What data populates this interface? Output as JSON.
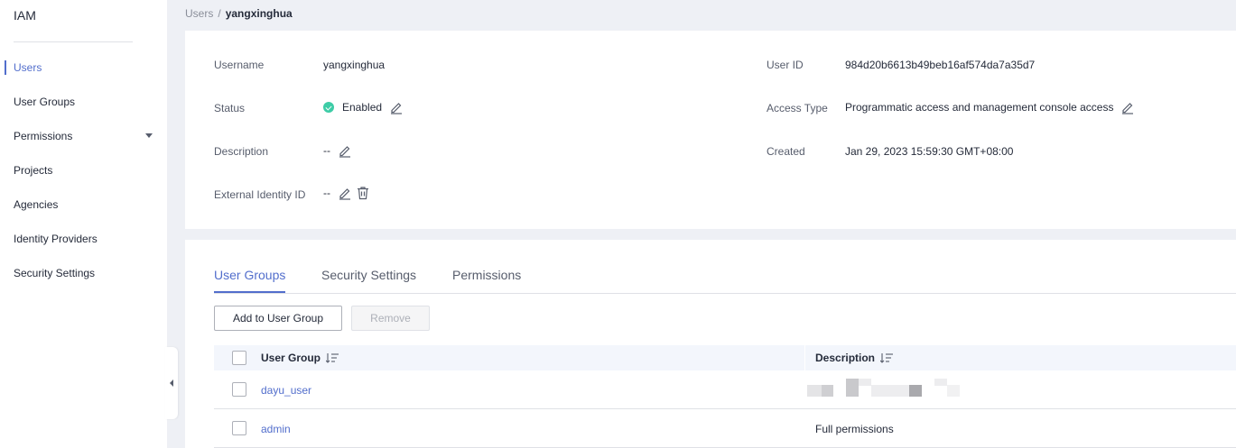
{
  "sidebar": {
    "brand": "IAM",
    "items": [
      {
        "label": "Users"
      },
      {
        "label": "User Groups"
      },
      {
        "label": "Permissions"
      },
      {
        "label": "Projects"
      },
      {
        "label": "Agencies"
      },
      {
        "label": "Identity Providers"
      },
      {
        "label": "Security Settings"
      }
    ]
  },
  "breadcrumb": {
    "parent": "Users",
    "separator": "/",
    "current": "yangxinghua"
  },
  "details": {
    "username_label": "Username",
    "username_value": "yangxinghua",
    "status_label": "Status",
    "status_value": "Enabled",
    "description_label": "Description",
    "description_value": "--",
    "external_id_label": "External Identity ID",
    "external_id_value": "--",
    "user_id_label": "User ID",
    "user_id_value": "984d20b6613b49beb16af574da7a35d7",
    "access_type_label": "Access Type",
    "access_type_value": "Programmatic access and management console access",
    "created_label": "Created",
    "created_value": "Jan 29, 2023 15:59:30 GMT+08:00"
  },
  "tabs": [
    {
      "label": "User Groups"
    },
    {
      "label": "Security Settings"
    },
    {
      "label": "Permissions"
    }
  ],
  "toolbar": {
    "add_label": "Add to User Group",
    "remove_label": "Remove"
  },
  "table": {
    "columns": [
      "User Group",
      "Description"
    ],
    "rows": [
      {
        "group": "dayu_user",
        "description": ""
      },
      {
        "group": "admin",
        "description": "Full permissions"
      }
    ]
  },
  "colors": {
    "accent": "#526ecc",
    "status_enabled": "#3dcca6"
  }
}
